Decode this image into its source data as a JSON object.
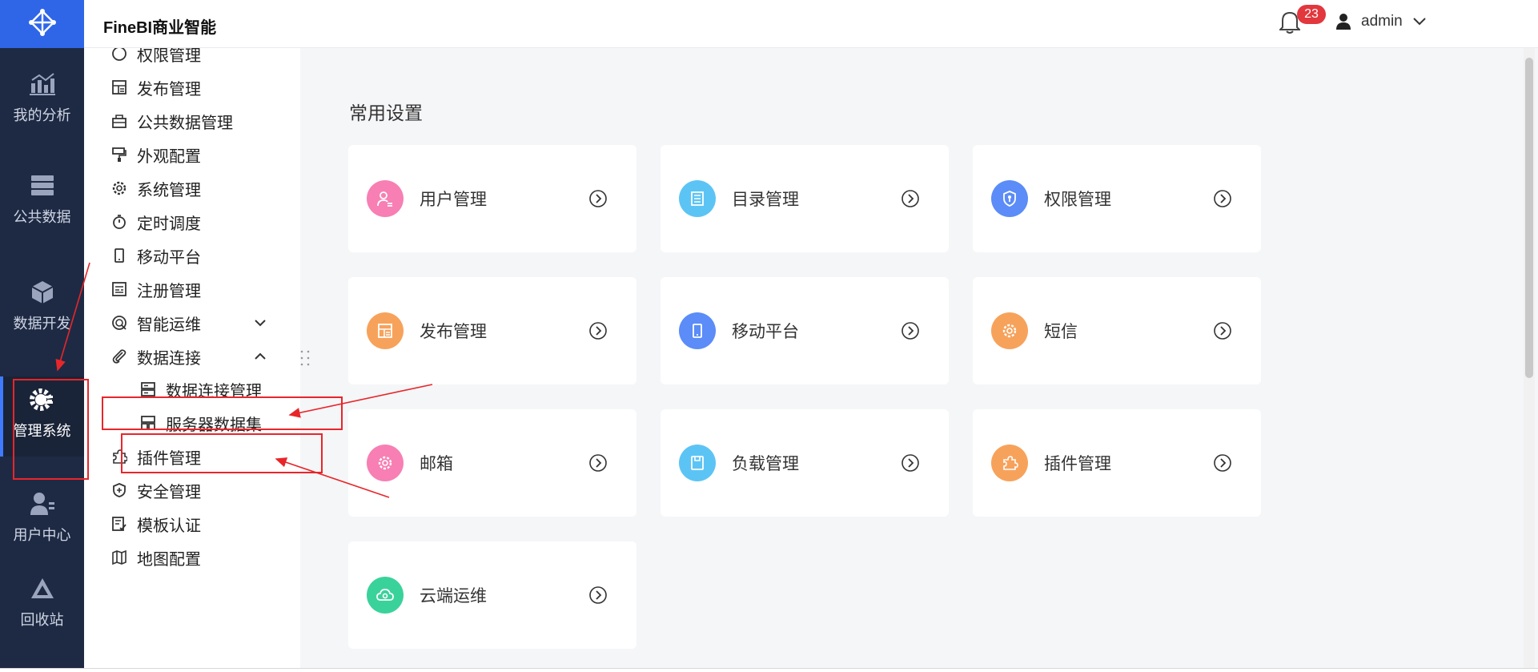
{
  "app": {
    "title": "FineBI商业智能"
  },
  "header": {
    "notification_count": "23",
    "username": "admin"
  },
  "rail": {
    "items": [
      {
        "label": "我的分析",
        "icon": "chart-icon"
      },
      {
        "label": "公共数据",
        "icon": "data-stack-icon"
      },
      {
        "label": "数据开发",
        "icon": "cube-icon"
      },
      {
        "label": "管理系统",
        "icon": "gear-icon",
        "active": true
      },
      {
        "label": "用户中心",
        "icon": "user-icon"
      },
      {
        "label": "回收站",
        "icon": "recycle-icon"
      }
    ]
  },
  "submenu": {
    "items": [
      {
        "label": "权限管理",
        "icon": "shield-icon"
      },
      {
        "label": "发布管理",
        "icon": "publish-icon"
      },
      {
        "label": "公共数据管理",
        "icon": "public-data-icon"
      },
      {
        "label": "外观配置",
        "icon": "paint-icon"
      },
      {
        "label": "系统管理",
        "icon": "settings-icon"
      },
      {
        "label": "定时调度",
        "icon": "timer-icon"
      },
      {
        "label": "移动平台",
        "icon": "mobile-icon"
      },
      {
        "label": "注册管理",
        "icon": "register-icon"
      },
      {
        "label": "智能运维",
        "icon": "ops-icon",
        "expandable": true
      },
      {
        "label": "数据连接",
        "icon": "clip-icon",
        "expanded": true
      },
      {
        "label": "数据连接管理",
        "icon": "db-connect-icon",
        "child": true
      },
      {
        "label": "服务器数据集",
        "icon": "server-dataset-icon",
        "child": true
      },
      {
        "label": "插件管理",
        "icon": "plugin-icon"
      },
      {
        "label": "安全管理",
        "icon": "security-icon"
      },
      {
        "label": "模板认证",
        "icon": "template-icon"
      },
      {
        "label": "地图配置",
        "icon": "map-icon"
      }
    ]
  },
  "main": {
    "section_title": "常用设置",
    "cards": [
      {
        "label": "用户管理",
        "icon": "user-manage-icon",
        "color": "#f77fb3"
      },
      {
        "label": "目录管理",
        "icon": "directory-icon",
        "color": "#5cc4f5"
      },
      {
        "label": "权限管理",
        "icon": "permission-icon",
        "color": "#5b8cf7"
      },
      {
        "label": "发布管理",
        "icon": "publish-icon",
        "color": "#f7a25b"
      },
      {
        "label": "移动平台",
        "icon": "mobile-icon",
        "color": "#5b8cf7"
      },
      {
        "label": "短信",
        "icon": "sms-icon",
        "color": "#f7a25b"
      },
      {
        "label": "邮箱",
        "icon": "mail-icon",
        "color": "#f77fb3"
      },
      {
        "label": "负载管理",
        "icon": "load-icon",
        "color": "#5cc4f5"
      },
      {
        "label": "插件管理",
        "icon": "plugin-icon",
        "color": "#f7a25b"
      },
      {
        "label": "云端运维",
        "icon": "cloud-icon",
        "color": "#3ad29b"
      }
    ]
  },
  "colors": {
    "rail_bg": "#1e2a44",
    "logo_bg": "#2f66e8",
    "annotation_red": "#e8262a"
  }
}
